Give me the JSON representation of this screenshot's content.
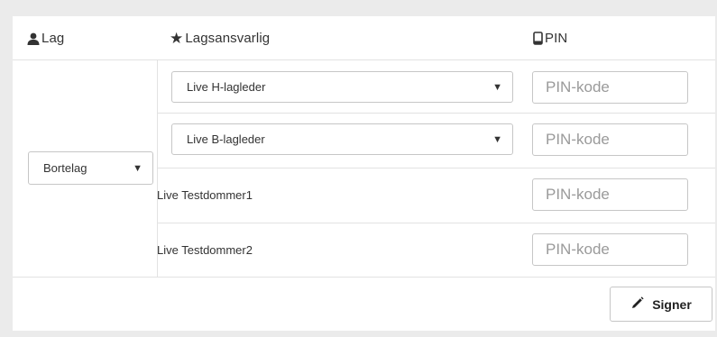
{
  "headers": {
    "team": "Lag",
    "responsible": "Lagsansvarlig",
    "pin": "PIN"
  },
  "team_select": {
    "value": "Bortelag"
  },
  "rows": [
    {
      "name": "Live H-lagleder",
      "kind": "select",
      "pin_placeholder": "PIN-kode"
    },
    {
      "name": "Live B-lagleder",
      "kind": "select",
      "pin_placeholder": "PIN-kode"
    },
    {
      "name": "Live Testdommer1",
      "kind": "text",
      "pin_placeholder": "PIN-kode"
    },
    {
      "name": "Live Testdommer2",
      "kind": "text",
      "pin_placeholder": "PIN-kode"
    }
  ],
  "sign_button": {
    "label": "Signer"
  },
  "icons": {
    "team": "user-icon",
    "responsible": "star-icon",
    "pin": "mobile-phone-icon",
    "sign": "pencil-icon",
    "dropdown": "caret-down-icon"
  }
}
